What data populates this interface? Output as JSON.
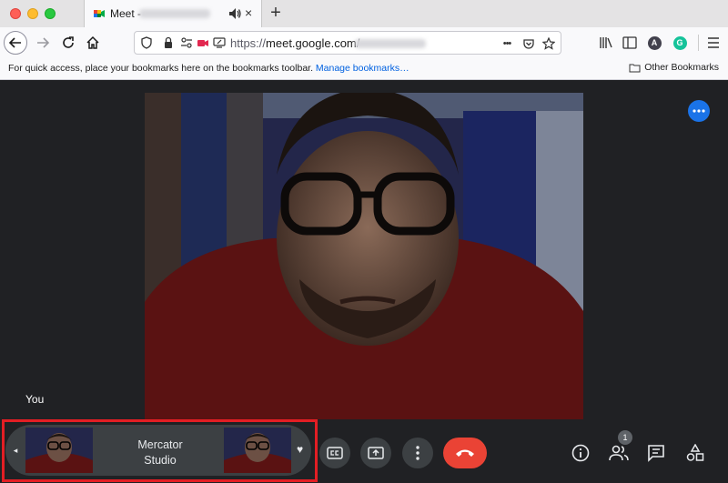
{
  "browser": {
    "tab_title": "Meet -",
    "new_tab_label": "+",
    "tab_close_label": "×",
    "url_scheme": "https://",
    "url_host": "meet.google.com",
    "url_path": "/",
    "avatar_a": "A",
    "avatar_g": "G",
    "url_more_label": "•••"
  },
  "bookmarks_bar": {
    "hint_text": "For quick access, place your bookmarks here on the bookmarks toolbar.",
    "manage_link": "Manage bookmarks…",
    "other_bookmarks": "Other Bookmarks"
  },
  "meet": {
    "self_label": "You",
    "studio_name_line1": "Mercator",
    "studio_name_line2": "Studio",
    "participant_count": "1",
    "arrow_left": "◂",
    "heart": "♥"
  },
  "colors": {
    "meet_bg": "#202124",
    "accent_blue": "#1a73e8",
    "end_call_red": "#ea4335",
    "highlight_red": "#e31e24"
  }
}
